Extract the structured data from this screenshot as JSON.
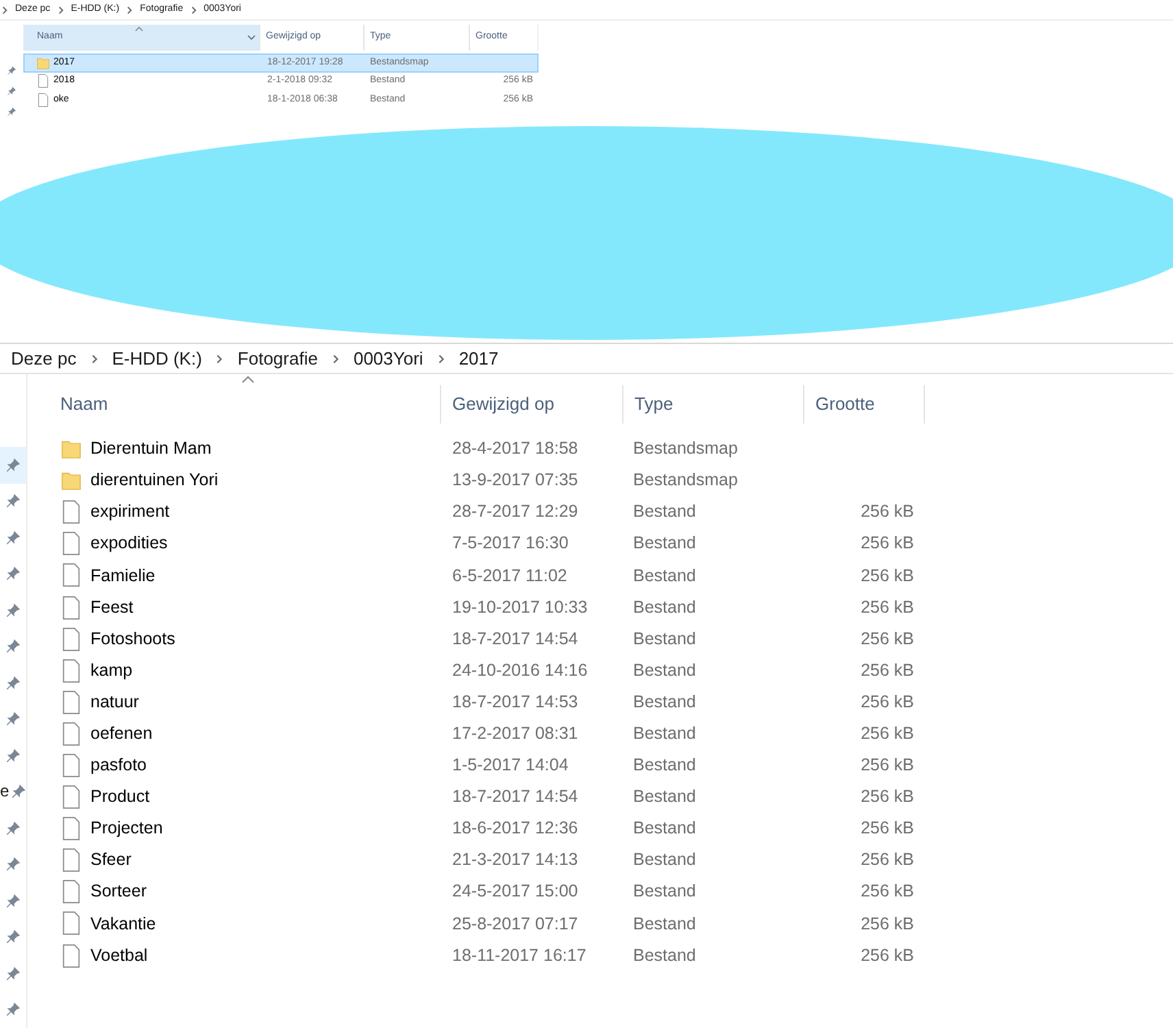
{
  "top_window": {
    "breadcrumb": [
      "Deze pc",
      "E-HDD (K:)",
      "Fotografie",
      "0003Yori"
    ],
    "columns": [
      "Naam",
      "Gewijzigd op",
      "Type",
      "Grootte"
    ],
    "rows": [
      {
        "name": "2017",
        "modified": "18-12-2017 19:28",
        "type": "Bestandsmap",
        "size": "",
        "kind": "folder",
        "selected": true
      },
      {
        "name": "2018",
        "modified": "2-1-2018 09:32",
        "type": "Bestand",
        "size": "256 kB",
        "kind": "file",
        "selected": false
      },
      {
        "name": "oke",
        "modified": "18-1-2018 06:38",
        "type": "Bestand",
        "size": "256 kB",
        "kind": "file",
        "selected": false
      }
    ],
    "pins": [
      {
        "selected": false
      },
      {
        "selected": false
      },
      {
        "selected": false
      }
    ]
  },
  "bottom_window": {
    "breadcrumb": [
      "Deze pc",
      "E-HDD (K:)",
      "Fotografie",
      "0003Yori",
      "2017"
    ],
    "columns": [
      "Naam",
      "Gewijzigd op",
      "Type",
      "Grootte"
    ],
    "sidebar_label": "e",
    "rows": [
      {
        "name": "Dierentuin Mam",
        "modified": "28-4-2017 18:58",
        "type": "Bestandsmap",
        "size": "",
        "kind": "folder"
      },
      {
        "name": "dierentuinen Yori",
        "modified": "13-9-2017 07:35",
        "type": "Bestandsmap",
        "size": "",
        "kind": "folder"
      },
      {
        "name": "expiriment",
        "modified": "28-7-2017 12:29",
        "type": "Bestand",
        "size": "256 kB",
        "kind": "file"
      },
      {
        "name": "expodities",
        "modified": "7-5-2017 16:30",
        "type": "Bestand",
        "size": "256 kB",
        "kind": "file"
      },
      {
        "name": "Famielie",
        "modified": "6-5-2017 11:02",
        "type": "Bestand",
        "size": "256 kB",
        "kind": "file"
      },
      {
        "name": "Feest",
        "modified": "19-10-2017 10:33",
        "type": "Bestand",
        "size": "256 kB",
        "kind": "file"
      },
      {
        "name": "Fotoshoots",
        "modified": "18-7-2017 14:54",
        "type": "Bestand",
        "size": "256 kB",
        "kind": "file"
      },
      {
        "name": "kamp",
        "modified": "24-10-2016 14:16",
        "type": "Bestand",
        "size": "256 kB",
        "kind": "file"
      },
      {
        "name": "natuur",
        "modified": "18-7-2017 14:53",
        "type": "Bestand",
        "size": "256 kB",
        "kind": "file"
      },
      {
        "name": "oefenen",
        "modified": "17-2-2017 08:31",
        "type": "Bestand",
        "size": "256 kB",
        "kind": "file"
      },
      {
        "name": "pasfoto",
        "modified": "1-5-2017 14:04",
        "type": "Bestand",
        "size": "256 kB",
        "kind": "file"
      },
      {
        "name": "Product",
        "modified": "18-7-2017 14:54",
        "type": "Bestand",
        "size": "256 kB",
        "kind": "file"
      },
      {
        "name": "Projecten",
        "modified": "18-6-2017 12:36",
        "type": "Bestand",
        "size": "256 kB",
        "kind": "file"
      },
      {
        "name": "Sfeer",
        "modified": "21-3-2017 14:13",
        "type": "Bestand",
        "size": "256 kB",
        "kind": "file"
      },
      {
        "name": "Sorteer",
        "modified": "24-5-2017 15:00",
        "type": "Bestand",
        "size": "256 kB",
        "kind": "file"
      },
      {
        "name": "Vakantie",
        "modified": "25-8-2017 07:17",
        "type": "Bestand",
        "size": "256 kB",
        "kind": "file"
      },
      {
        "name": "Voetbal",
        "modified": "18-11-2017 16:17",
        "type": "Bestand",
        "size": "256 kB",
        "kind": "file"
      }
    ],
    "pins": [
      {
        "selected": true
      },
      {
        "selected": false
      },
      {
        "selected": false
      },
      {
        "selected": false
      },
      {
        "selected": false
      },
      {
        "selected": false
      },
      {
        "selected": false
      },
      {
        "selected": false
      },
      {
        "selected": false
      },
      {
        "selected": false
      },
      {
        "selected": false
      },
      {
        "selected": false
      },
      {
        "selected": false
      },
      {
        "selected": false
      },
      {
        "selected": false
      },
      {
        "selected": false
      }
    ]
  }
}
